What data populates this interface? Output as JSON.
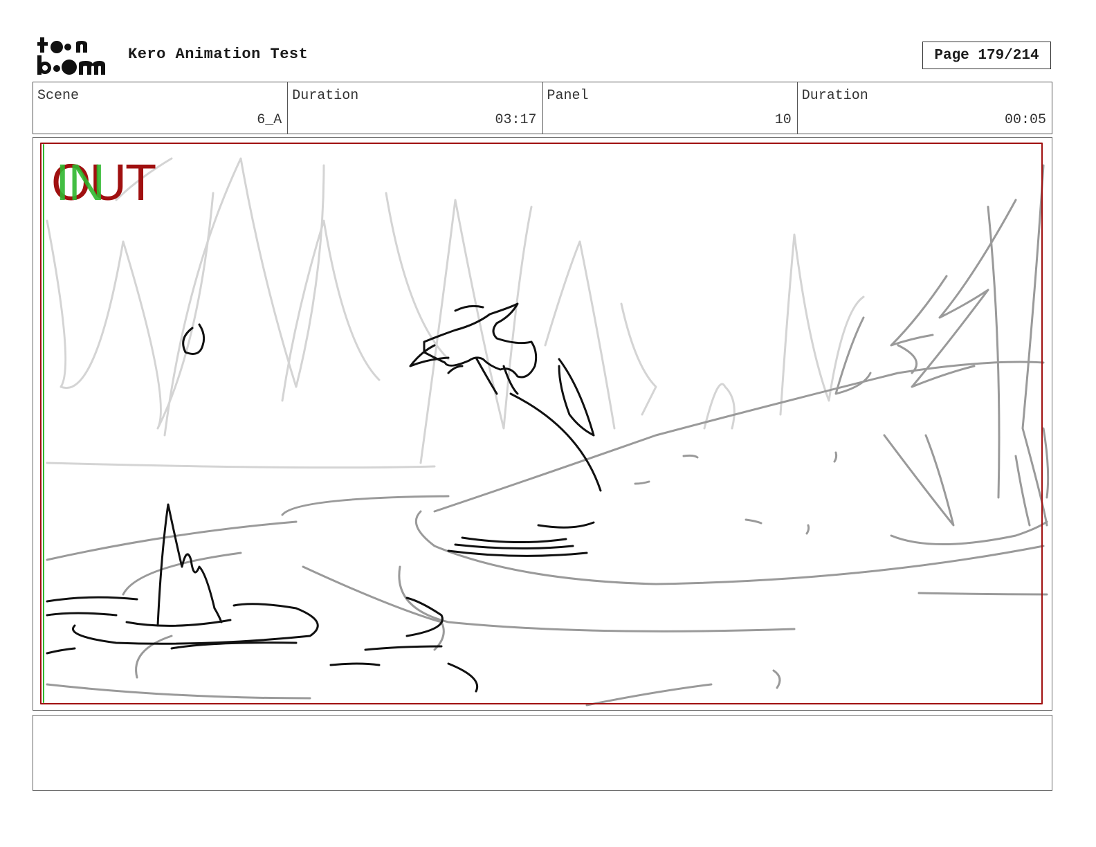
{
  "header": {
    "logo_alt": "toon boom",
    "title": "Kero Animation Test",
    "page_label": "Page 179/214"
  },
  "info": [
    {
      "label": "Scene",
      "value": "6_A"
    },
    {
      "label": "Duration",
      "value": "03:17"
    },
    {
      "label": "Panel",
      "value": "10"
    },
    {
      "label": "Duration",
      "value": "00:05"
    }
  ],
  "panel": {
    "overlay_in": "IN",
    "overlay_out": "OUT",
    "colors": {
      "in": "#2fb82f",
      "out": "#a01010",
      "safe_frame": "#a01010"
    }
  },
  "notes": {
    "text": ""
  }
}
